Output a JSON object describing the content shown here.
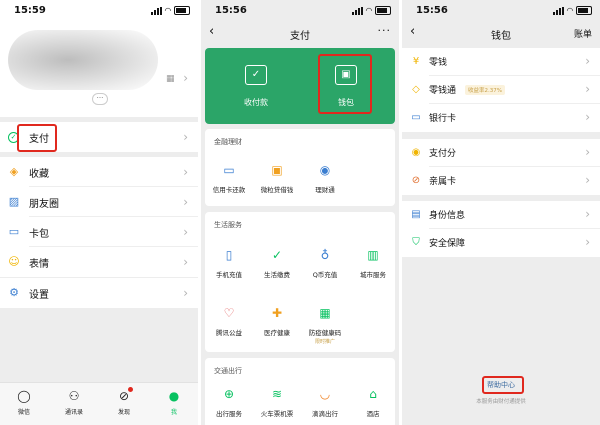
{
  "colors": {
    "accent": "#07c160",
    "green_card": "#2ba568",
    "highlight": "#e0281e"
  },
  "panel1": {
    "time": "15:59",
    "menu": [
      {
        "label": "支付",
        "icon": "pay-check-icon"
      },
      {
        "label": "收藏",
        "icon": "cube-icon"
      },
      {
        "label": "朋友圈",
        "icon": "image-icon"
      },
      {
        "label": "卡包",
        "icon": "wallet-icon"
      },
      {
        "label": "表情",
        "icon": "smiley-icon"
      },
      {
        "label": "设置",
        "icon": "gear-icon"
      }
    ],
    "tabs": [
      {
        "label": "微信",
        "icon": "chat-icon"
      },
      {
        "label": "通讯录",
        "icon": "contacts-icon"
      },
      {
        "label": "发现",
        "icon": "compass-icon"
      },
      {
        "label": "我",
        "icon": "person-icon"
      }
    ]
  },
  "panel2": {
    "time": "15:56",
    "title": "支付",
    "green": [
      {
        "label": "收付款",
        "icon": "scan-icon"
      },
      {
        "label": "钱包",
        "icon": "wallet-icon"
      }
    ],
    "sections": [
      {
        "title": "金融理财",
        "items": [
          {
            "label": "信用卡还款",
            "icon": "credit-card-icon"
          },
          {
            "label": "微粒贷借钱",
            "icon": "loan-icon"
          },
          {
            "label": "理财通",
            "icon": "finance-drop-icon"
          }
        ]
      },
      {
        "title": "生活服务",
        "items": [
          {
            "label": "手机充值",
            "icon": "phone-icon"
          },
          {
            "label": "生活缴费",
            "icon": "leaf-check-icon"
          },
          {
            "label": "Q币充值",
            "icon": "penguin-icon"
          },
          {
            "label": "城市服务",
            "icon": "city-icon"
          },
          {
            "label": "腾讯公益",
            "icon": "heart-icon"
          },
          {
            "label": "医疗健康",
            "icon": "medical-cross-icon"
          },
          {
            "label": "防疫健康码",
            "icon": "health-code-icon",
            "sub": "限时推广"
          }
        ]
      },
      {
        "title": "交通出行",
        "items": [
          {
            "label": "出行服务",
            "icon": "car-icon"
          },
          {
            "label": "火车票机票",
            "icon": "train-icon"
          },
          {
            "label": "滴滴出行",
            "icon": "didi-icon"
          },
          {
            "label": "酒店",
            "icon": "hotel-icon"
          }
        ]
      }
    ]
  },
  "panel3": {
    "time": "15:56",
    "title": "钱包",
    "bill": "账单",
    "rows": [
      {
        "label": "零钱",
        "icon": "coin-icon"
      },
      {
        "label": "零钱通",
        "icon": "diamond-icon",
        "badge": "收益率2.37%"
      },
      {
        "label": "银行卡",
        "icon": "bank-card-icon"
      },
      {
        "label": "支付分",
        "icon": "score-icon"
      },
      {
        "label": "亲属卡",
        "icon": "family-card-icon"
      },
      {
        "label": "身份信息",
        "icon": "id-card-icon"
      },
      {
        "label": "安全保障",
        "icon": "shield-icon"
      }
    ],
    "help": "帮助中心",
    "note": "本服务由财付通提供"
  }
}
